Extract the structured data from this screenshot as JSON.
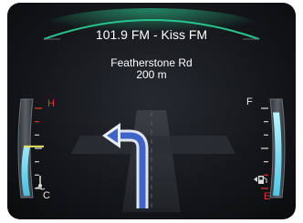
{
  "radio": {
    "station": "101.9 FM - Kiss FM"
  },
  "navigation": {
    "street": "Featherstone Rd",
    "distance": "200 m",
    "maneuver_icon": "turn-left-arrow-icon"
  },
  "temperature_gauge": {
    "high_label": "H",
    "low_label": "C",
    "icon": "coolant-temperature-icon",
    "level": 0.52
  },
  "fuel_gauge": {
    "full_label": "F",
    "empty_label": "E",
    "icon": "fuel-pump-icon",
    "level": 0.88
  },
  "colors": {
    "arc_accent": "#27c48d",
    "gauge_fill": "#7fe0f0",
    "warning_red": "#e03a2e",
    "needle_yellow": "#e6e65a",
    "arrow_blue": "#3f64c8"
  }
}
